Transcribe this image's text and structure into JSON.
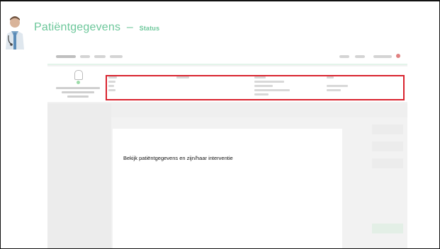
{
  "slide": {
    "title": "Patiëntgegevens",
    "separator": "–",
    "subtitle": "Status"
  },
  "modal": {
    "text": "Bekijk patiëntgegevens en zijn/haar interventie"
  },
  "colors": {
    "title_green": "#6cc79a",
    "highlight_red": "#d9232e"
  },
  "icons": [
    "doctor-avatar-icon",
    "user-profile-icon"
  ]
}
